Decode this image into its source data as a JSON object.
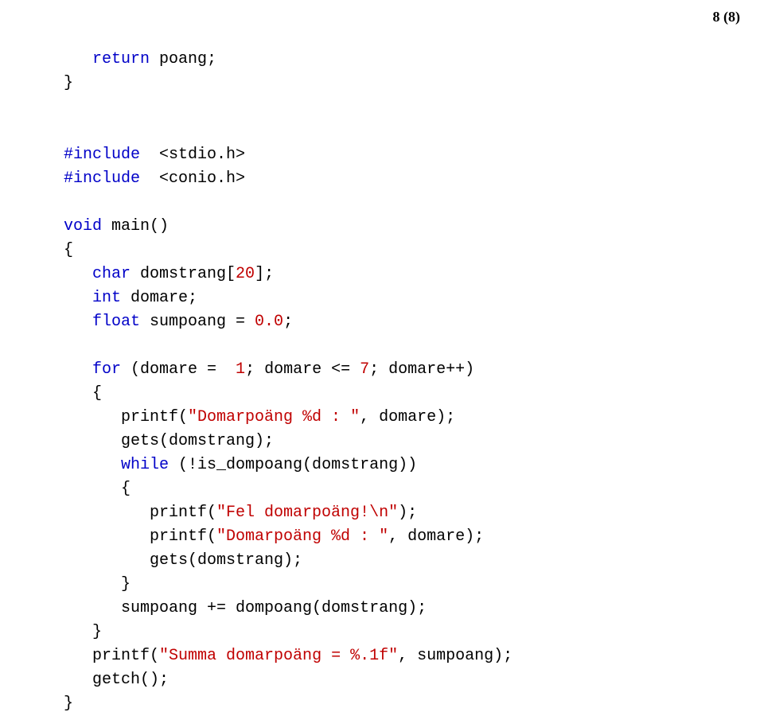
{
  "pageNumber": "8 (8)",
  "code": {
    "l1a": "   return",
    "l1b": " poang;",
    "l2": "}",
    "l3": "",
    "l4": "",
    "l5a": "#include",
    "l5b": "  <stdio.h>",
    "l6a": "#include",
    "l6b": "  <conio.h>",
    "l7": "",
    "l8a": "void",
    "l8b": " main()",
    "l9": "{",
    "l10a": "   char",
    "l10b": " domstrang[",
    "l10c": "20",
    "l10d": "];",
    "l11a": "   int",
    "l11b": " domare;",
    "l12a": "   float",
    "l12b": " sumpoang = ",
    "l12c": "0.0",
    "l12d": ";",
    "l13": "",
    "l14a": "   for",
    "l14b": " (domare =  ",
    "l14c": "1",
    "l14d": "; domare <= ",
    "l14e": "7",
    "l14f": "; domare++)",
    "l15": "   {",
    "l16a": "      printf(",
    "l16b": "\"Domarpoäng %d : \"",
    "l16c": ", domare);",
    "l17": "      gets(domstrang);",
    "l18a": "      while",
    "l18b": " (!is_dompoang(domstrang))",
    "l19": "      {",
    "l20a": "         printf(",
    "l20b": "\"Fel domarpoäng!\\n\"",
    "l20c": ");",
    "l21a": "         printf(",
    "l21b": "\"Domarpoäng %d : \"",
    "l21c": ", domare);",
    "l22": "         gets(domstrang);",
    "l23": "      }",
    "l24": "      sumpoang += dompoang(domstrang);",
    "l25": "   }",
    "l26a": "   printf(",
    "l26b": "\"Summa domarpoäng = %.1f\"",
    "l26c": ", sumpoang);",
    "l27": "   getch();",
    "l28": "}"
  }
}
